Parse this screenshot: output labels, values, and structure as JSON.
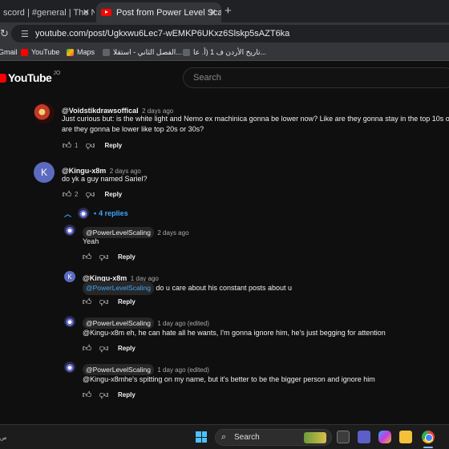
{
  "browser": {
    "tabs": [
      {
        "label": "scord | #general | The New",
        "active": false
      },
      {
        "label": "Post from Power Level Scaling",
        "active": true
      }
    ],
    "close_glyph": "✕",
    "new_tab_glyph": "+",
    "url": "youtube.com/post/Ugkxwu6Lec7-wEMKP6UKxz6Slskp5sAZT6ka",
    "bookmarks": [
      {
        "label": "Gmail",
        "icon": "gmail-icon"
      },
      {
        "label": "YouTube",
        "icon": "youtube-icon"
      },
      {
        "label": "Maps",
        "icon": "maps-icon"
      },
      {
        "label": "الفصل الثاني - استقلا...",
        "icon": "bookmark-icon"
      },
      {
        "label": "تاريخ الأردن ف 1 (أ. عا...",
        "icon": "bookmark-icon"
      }
    ]
  },
  "youtube": {
    "logo_text": "YouTube",
    "country_code": "JO",
    "search_placeholder": "Search"
  },
  "comments": [
    {
      "author": "@Voidstikdrawsoffical",
      "time": "2 days ago",
      "text_line1": "Just curious but: is the white light and Nemo ex machinica gonna be lower now? Like are they gonna stay in the top 10s or",
      "text_line2": "are they gonna be lower like top 20s or 30s?",
      "likes": "1",
      "reply_label": "Reply"
    },
    {
      "author": "@Kingu-x8m",
      "avatar_letter": "K",
      "time": "2 days ago",
      "text": "do yk a guy named Sariel?",
      "likes": "2",
      "reply_label": "Reply",
      "replies_toggle": "4 replies",
      "replies": [
        {
          "author": "@PowerLevelScaling",
          "time": "2 days ago",
          "mention": "",
          "text": "Yeah",
          "reply_label": "Reply"
        },
        {
          "author": "@Kingu-x8m",
          "avatar_letter": "K",
          "time": "1 day ago",
          "mention": "@PowerLevelScaling",
          "text": " do u care about his constant posts about u",
          "reply_label": "Reply"
        },
        {
          "author": "@PowerLevelScaling",
          "time": "1 day ago (edited)",
          "mention": "",
          "text": "@Kingu-x8m eh, he can hate all he wants, I'm gonna ignore him, he's just begging for attention",
          "reply_label": "Reply"
        },
        {
          "author": "@PowerLevelScaling",
          "time": "1 day ago (edited)",
          "mention": "",
          "text": "@Kingu-x8mhe's spitting on my name, but it's better to be the bigger person and ignore him",
          "reply_label": "Reply"
        }
      ]
    }
  ],
  "taskbar": {
    "search_label": "Search",
    "left_text": "ص"
  },
  "colors": {
    "background": "#0f0f0f",
    "link": "#3ea6ff",
    "brand_red": "#ff0000"
  }
}
